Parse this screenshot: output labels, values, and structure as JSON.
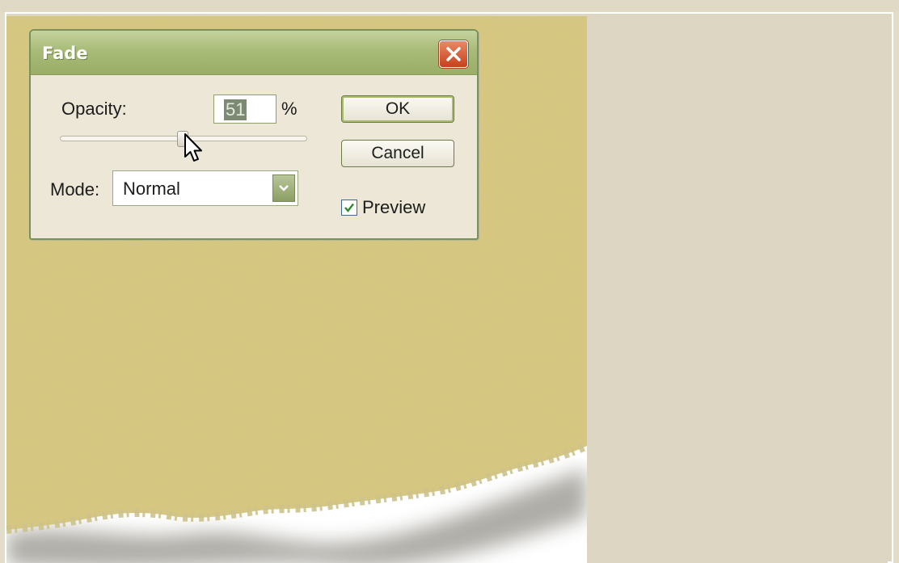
{
  "dialog": {
    "title": "Fade",
    "opacity_label": "Opacity:",
    "opacity_value": "51",
    "opacity_unit": "%",
    "opacity_slider_value": 51,
    "mode_label": "Mode:",
    "mode_value": "Normal",
    "ok_label": "OK",
    "cancel_label": "Cancel",
    "preview_label": "Preview",
    "preview_checked": true,
    "close_icon": "close-icon"
  },
  "colors": {
    "paper": "#d8c77e",
    "titlebar": "#a9bb78",
    "close_button": "#c8401c",
    "panel": "#ddd6c3"
  }
}
